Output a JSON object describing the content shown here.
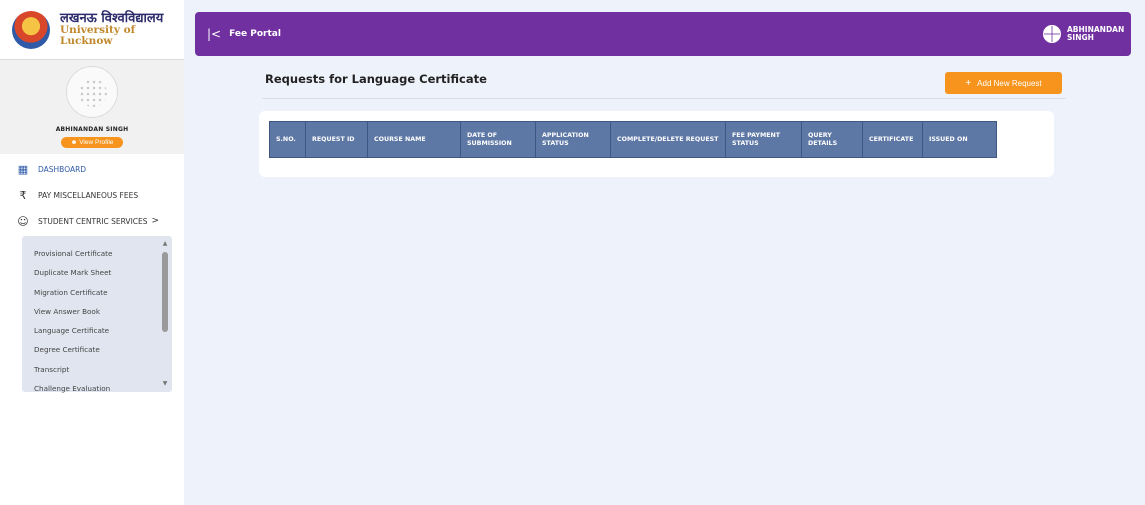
{
  "brand": {
    "hindi": "लखनऊ विश्वविद्यालय",
    "english": "University of Lucknow"
  },
  "profile": {
    "name": "ABHINANDAN SINGH",
    "view_profile": "View Profile"
  },
  "nav": [
    {
      "label": "DASHBOARD",
      "icon": "dashboard-icon"
    },
    {
      "label": "PAY MISCELLANEOUS FEES",
      "icon": "rupee-icon"
    },
    {
      "label": "STUDENT CENTRIC SERVICES",
      "icon": "user-icon",
      "chevron": ">"
    }
  ],
  "submenu": [
    "Provisional Certificate",
    "Duplicate Mark Sheet",
    "Migration Certificate",
    "View Answer Book",
    "Language Certificate",
    "Degree Certificate",
    "Transcript",
    "Challenge Evaluation"
  ],
  "header": {
    "collapse": "|<",
    "title": "Fee Portal",
    "user": "ABHINANDAN SINGH"
  },
  "main": {
    "title": "Requests for Language Certificate",
    "add_button": "Add New Request",
    "add_icon": "+"
  },
  "table": {
    "headers": [
      "S.NO.",
      "REQUEST ID",
      "COURSE NAME",
      "DATE OF SUBMISSION",
      "APPLICATION STATUS",
      "COMPLETE/DELETE REQUEST",
      "FEE PAYMENT STATUS",
      "QUERY DETAILS",
      "CERTIFICATE",
      "ISSUED ON"
    ]
  },
  "colors": {
    "header_purple": "#7030a0",
    "accent_orange": "#f7941d",
    "table_header": "#5e78a6",
    "active_blue": "#2e5aa8"
  }
}
